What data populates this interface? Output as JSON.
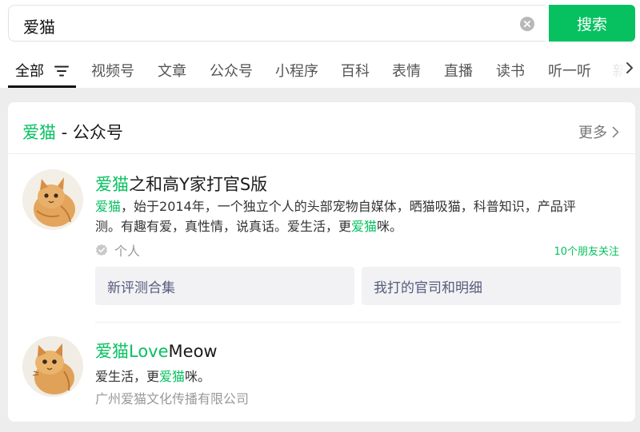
{
  "search": {
    "query": "爱猫",
    "button_label": "搜索"
  },
  "tabs": [
    {
      "label": "全部",
      "active": true
    },
    {
      "label": "视频号"
    },
    {
      "label": "文章"
    },
    {
      "label": "公众号"
    },
    {
      "label": "小程序"
    },
    {
      "label": "百科"
    },
    {
      "label": "表情"
    },
    {
      "label": "直播"
    },
    {
      "label": "读书"
    },
    {
      "label": "听一听"
    },
    {
      "label": "新"
    }
  ],
  "section": {
    "title_keyword": "爱猫",
    "title_rest": " - 公众号",
    "more_label": "更多"
  },
  "accounts": [
    {
      "name_keyword": "爱猫",
      "name_rest": "之和高Y家打官S版",
      "desc_parts": [
        "爱猫",
        "，始于2014年，一个独立个人的头部宠物自媒体，晒猫吸猫，科普知识，产品评测。有趣有爱，真性情，说真话。爱生活，更",
        "爱猫",
        "咪。"
      ],
      "type_label": "个人",
      "friends_label": "10个朋友关注",
      "sub_links": [
        "新评测合集",
        "我打的官司和明细"
      ]
    },
    {
      "name_keyword": "爱猫",
      "name_mid": "Love",
      "name_rest": "Meow",
      "desc_parts": [
        "爱生活，更",
        "爱猫",
        "咪。"
      ],
      "org": "广州爱猫文化传播有限公司"
    }
  ],
  "colors": {
    "accent": "#07c160",
    "background": "#ededed",
    "sub_link_bg": "#f2f2f5",
    "sub_link_text": "#555c7a"
  }
}
